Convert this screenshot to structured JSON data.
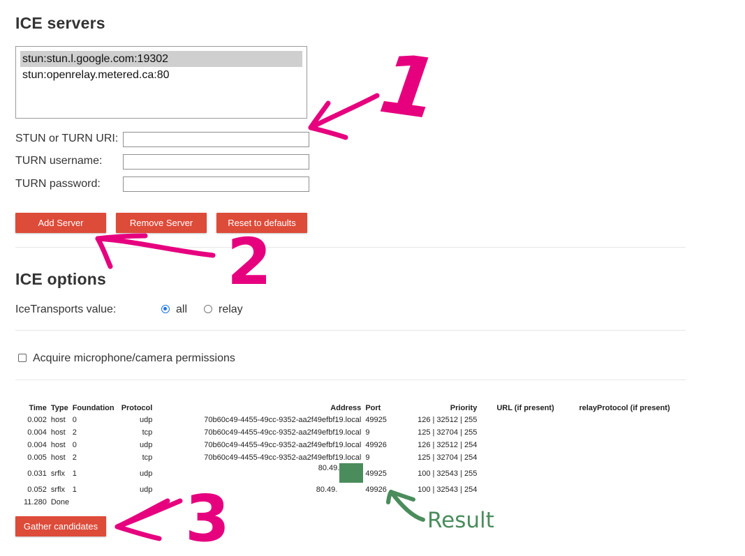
{
  "ice_servers": {
    "heading": "ICE servers",
    "servers": [
      "stun:stun.l.google.com:19302",
      "stun:openrelay.metered.ca:80"
    ],
    "uri_label": "STUN or TURN URI:",
    "username_label": "TURN username:",
    "password_label": "TURN password:",
    "uri_value": "",
    "username_value": "",
    "password_value": "",
    "add_button": "Add Server",
    "remove_button": "Remove Server",
    "reset_button": "Reset to defaults"
  },
  "ice_options": {
    "heading": "ICE options",
    "transports_label": "IceTransports value:",
    "option_all": "all",
    "option_relay": "relay",
    "selected": "all",
    "permissions_label": "Acquire microphone/camera permissions",
    "permissions_checked": false
  },
  "candidates": {
    "columns": [
      "Time",
      "Type",
      "Foundation",
      "Protocol",
      "Address",
      "Port",
      "Priority",
      "URL (if present)",
      "relayProtocol (if present)"
    ],
    "rows": [
      {
        "time": "0.002",
        "type": "host",
        "foundation": "0",
        "protocol": "udp",
        "address": "70b60c49-4455-49cc-9352-aa2f49efbf19.local",
        "port": "49925",
        "priority": "126 | 32512 | 255"
      },
      {
        "time": "0.004",
        "type": "host",
        "foundation": "2",
        "protocol": "tcp",
        "address": "70b60c49-4455-49cc-9352-aa2f49efbf19.local",
        "port": "9",
        "priority": "125 | 32704 | 255"
      },
      {
        "time": "0.004",
        "type": "host",
        "foundation": "0",
        "protocol": "udp",
        "address": "70b60c49-4455-49cc-9352-aa2f49efbf19.local",
        "port": "49926",
        "priority": "126 | 32512 | 254"
      },
      {
        "time": "0.005",
        "type": "host",
        "foundation": "2",
        "protocol": "tcp",
        "address": "70b60c49-4455-49cc-9352-aa2f49efbf19.local",
        "port": "9",
        "priority": "125 | 32704 | 254"
      },
      {
        "time": "0.031",
        "type": "srflx",
        "foundation": "1",
        "protocol": "udp",
        "address": "80.49.",
        "port": "49925",
        "priority": "100 | 32543 | 255"
      },
      {
        "time": "0.052",
        "type": "srflx",
        "foundation": "1",
        "protocol": "udp",
        "address": "80.49.",
        "port": "49926",
        "priority": "100 | 32543 | 254"
      }
    ],
    "done_time": "11.280",
    "done_label": "Done",
    "gather_button": "Gather candidates"
  },
  "annotations": {
    "marker_1": "1",
    "marker_2": "2",
    "marker_3": "3",
    "result_label": "Result",
    "marker_color": "#e6007e",
    "result_color": "#4a8c5c",
    "redaction_color": "#4a8c5c"
  },
  "colors": {
    "button": "#dd4b39",
    "radio_selected": "#1a73e8"
  }
}
